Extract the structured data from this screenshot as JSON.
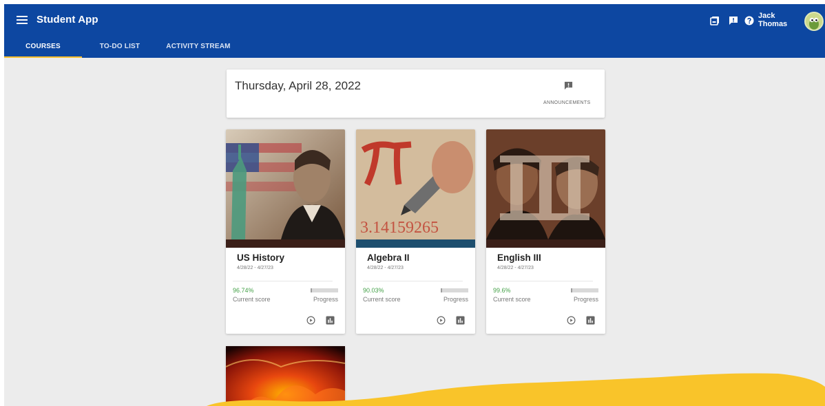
{
  "app": {
    "title": "Student App"
  },
  "tabs": [
    {
      "label": "COURSES",
      "active": true
    },
    {
      "label": "TO-DO LIST",
      "active": false
    },
    {
      "label": "ACTIVITY STREAM",
      "active": false
    }
  ],
  "header": {
    "icons": [
      "gallery-icon",
      "feedback-icon",
      "help-icon"
    ],
    "user": {
      "first_name": "Jack",
      "last_name": "Thomas"
    }
  },
  "date_card": {
    "date": "Thursday, April 28, 2022",
    "announcements_label": "ANNOUNCEMENTS"
  },
  "courses": [
    {
      "name": "US History",
      "dates": "4/28/22 - 4/27/23",
      "score": "96.74%",
      "score_label": "Current score",
      "progress": 0.05,
      "progress_label": "Progress"
    },
    {
      "name": "Algebra II",
      "dates": "4/28/22 - 4/27/23",
      "score": "90.03%",
      "score_label": "Current score",
      "progress": 0.05,
      "progress_label": "Progress"
    },
    {
      "name": "English III",
      "dates": "4/28/22 - 4/27/23",
      "score": "99.6%",
      "score_label": "Current score",
      "progress": 0.05,
      "progress_label": "Progress"
    }
  ],
  "colors": {
    "primary": "#0d47a1",
    "accent": "#fbc02d",
    "score": "#43a047"
  }
}
